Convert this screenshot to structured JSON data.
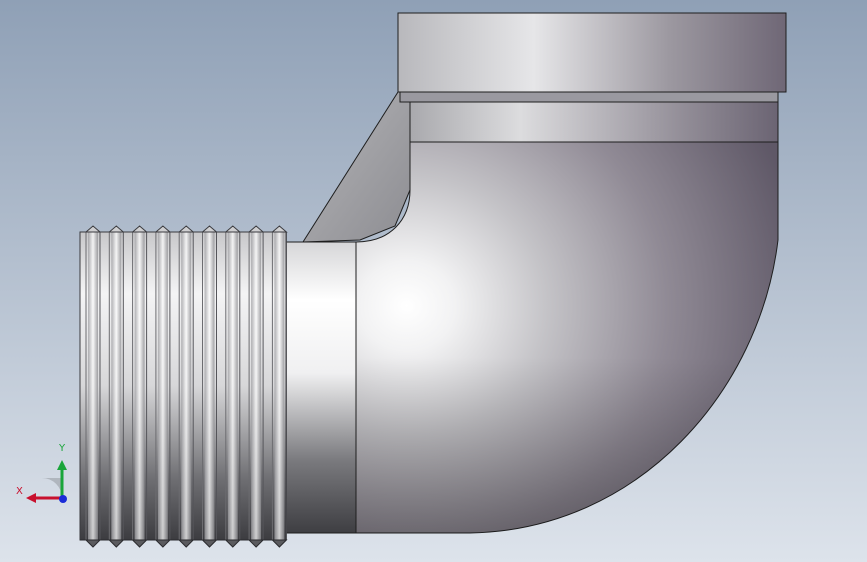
{
  "viewport": {
    "background_top": "#8fa0b6",
    "background_bottom": "#dde3eb"
  },
  "model": {
    "part": "street-elbow-90",
    "metal_highlight": "#ffffff",
    "metal_mid": "#b9b9bd",
    "metal_shadow": "#6e6676",
    "outline": "#1e1e1e"
  },
  "triad": {
    "x_label": "X",
    "y_label": "Y",
    "x_color": "#c8102e",
    "y_color": "#19a53a",
    "z_color": "#1a2bd8"
  }
}
